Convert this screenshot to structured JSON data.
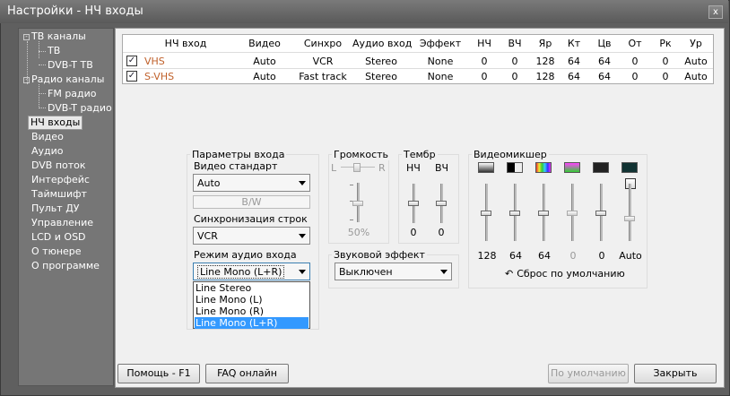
{
  "window": {
    "title": "Настройки - НЧ входы",
    "close_glyph": "x"
  },
  "sidebar": {
    "items": [
      {
        "label": "ТВ каналы",
        "toggle": "-"
      },
      {
        "label": "ТВ"
      },
      {
        "label": "DVB-T ТВ"
      },
      {
        "label": "Радио каналы",
        "toggle": "-"
      },
      {
        "label": "FM радио"
      },
      {
        "label": "DVB-T радио"
      },
      {
        "label": "НЧ входы",
        "selected": true
      },
      {
        "label": "Видео"
      },
      {
        "label": "Аудио"
      },
      {
        "label": "DVB поток"
      },
      {
        "label": "Интерфейс"
      },
      {
        "label": "Таймшифт"
      },
      {
        "label": "Пульт ДУ"
      },
      {
        "label": "Управление"
      },
      {
        "label": "LCD и OSD"
      },
      {
        "label": "О тюнере"
      },
      {
        "label": "О программе"
      }
    ]
  },
  "table": {
    "headers": [
      "НЧ вход",
      "Видео",
      "Синхро",
      "Аудио вход",
      "Эффект",
      "НЧ",
      "ВЧ",
      "Яр",
      "Кт",
      "Цв",
      "От",
      "Рк",
      "Ур"
    ],
    "check_glyph": "✓",
    "rows": [
      {
        "checked": true,
        "cells": [
          "VHS",
          "Auto",
          "VCR",
          "Stereo",
          "None",
          "0",
          "0",
          "128",
          "64",
          "64",
          "0",
          "0",
          "Auto"
        ]
      },
      {
        "checked": true,
        "cells": [
          "S-VHS",
          "Auto",
          "Fast track",
          "Stereo",
          "None",
          "0",
          "0",
          "128",
          "64",
          "64",
          "0",
          "0",
          "Auto"
        ]
      }
    ]
  },
  "input_params": {
    "group_label": "Параметры входа",
    "video_standard_label": "Видео стандарт",
    "video_standard_value": "Auto",
    "bw_label": "B/W",
    "line_sync_label": "Синхронизация строк",
    "line_sync_value": "VCR",
    "audio_mode_label": "Режим аудио входа",
    "audio_mode_value": "Line Mono (L+R)",
    "audio_mode_options": [
      "Line Stereo",
      "Line Mono (L)",
      "Line Mono (R)",
      "Line Mono (L+R)"
    ]
  },
  "volume": {
    "label": "Громкость",
    "left": "L",
    "right": "R",
    "value_text": "50%",
    "level": 0.5
  },
  "timbre": {
    "label": "Тембр",
    "bass_label": "НЧ",
    "treble_label": "ВЧ",
    "bass_value": "0",
    "treble_value": "0"
  },
  "sound_effect": {
    "label": "Звуковой эффект",
    "value": "Выключен"
  },
  "videomixer": {
    "label": "Видеомикшер",
    "icons": [
      "brightness-icon",
      "contrast-icon",
      "saturation-icon",
      "hue-icon",
      "sharpness-icon",
      "level-icon"
    ],
    "values": [
      "128",
      "64",
      "64",
      "0",
      "0",
      "Auto"
    ],
    "reset_label": "Сброс по умолчанию",
    "reset_glyph": "↶"
  },
  "footer": {
    "help_label": "Помощь - F1",
    "faq_label": "FAQ онлайн",
    "defaults_label": "По умолчанию",
    "close_label": "Закрыть"
  },
  "colors": {
    "accent": "#3399ff",
    "vhs_text": "#c0602a",
    "sidebar_bg": "#767676"
  }
}
